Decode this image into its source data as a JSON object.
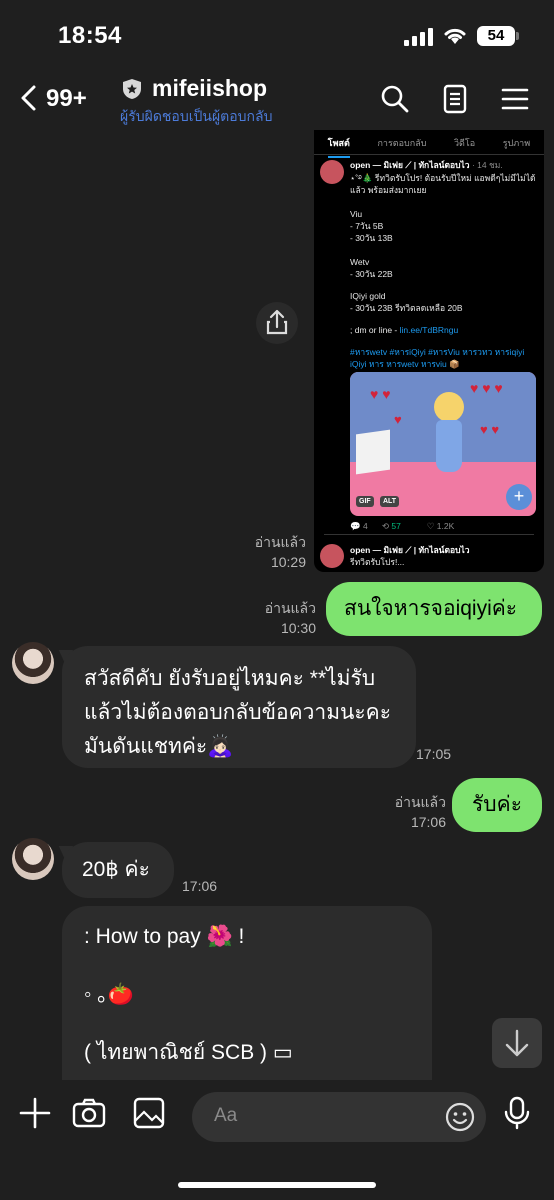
{
  "status_bar": {
    "time": "18:54",
    "battery": "54"
  },
  "header": {
    "back_count": "99+",
    "chat_name": "mifeiishop",
    "subtitle": "ผู้รับผิดชอบเป็นผู้ตอบกลับ",
    "icons": [
      "search-icon",
      "notes-icon",
      "menu-icon"
    ]
  },
  "shared_post": {
    "tabs": [
      "โพสต์",
      "การตอบกลับ",
      "วิดีโอ",
      "รูปภาพ"
    ],
    "author": "open — มิเฟย ⟋ | ทักไลน์ตอบไว",
    "age": "· 14 ชม.",
    "lines": [
      "⋆˚࿔🎄 รีทวิตรับโปร! ต้อนรับปีใหม่ แอพดีๆไม่มีไม่ได้",
      "แล้ว พร้อมส่งมากเยย",
      "Viu",
      "- 7วัน 5B",
      "- 30วัน 13B",
      "Wetv",
      "- 30วัน 22B",
      "IQiyi gold",
      "- 30วัน 23B รีทวิตลดเหลือ 20B",
      "; dm or line -",
      "lin.ee/TdBRngu",
      "#หารwetv #หารiQiyi #หารViu หารวทว หารiqiyi",
      "iQiyi หาร หารwetv หารviu 📦"
    ],
    "badges": [
      "GIF",
      "ALT"
    ],
    "stats": [
      "4",
      "57",
      "1.2K"
    ],
    "next_author": "open — มิเฟย ⟋ | ทักไลน์ตอบไว",
    "next_line": "รีทวิตรับโปร!..."
  },
  "messages": {
    "m1": {
      "read": "อ่านแล้ว",
      "time": "10:29"
    },
    "m2": {
      "read": "อ่านแล้ว",
      "time": "10:30",
      "text": "สนใจหารจอiqiyiค่ะ"
    },
    "m3": {
      "line1": "สวัสดีคับ ยังรับอยู่ไหมคะ **ไม่รับ",
      "line2": "แล้วไม่ต้องตอบกลับข้อความนะคะ",
      "line3": "มันดันแชทค่ะ🙇🏻‍♀️",
      "time": "17:05"
    },
    "m4": {
      "read": "อ่านแล้ว",
      "time": "17:06",
      "text": "รับค่ะ"
    },
    "m5": {
      "text": "20฿ ค่ะ",
      "time": "17:06"
    },
    "m6": {
      "line1": ": How to pay 🌺 !",
      "line2": "◦ ｡🍅",
      "line3": "( ไทยพาณิชย์ SCB ) ▭"
    }
  },
  "input": {
    "placeholder": "Aa"
  },
  "colors": {
    "accent_green": "#7ee36f",
    "link_blue": "#4c7bd9",
    "bg": "#1f1f1f"
  }
}
